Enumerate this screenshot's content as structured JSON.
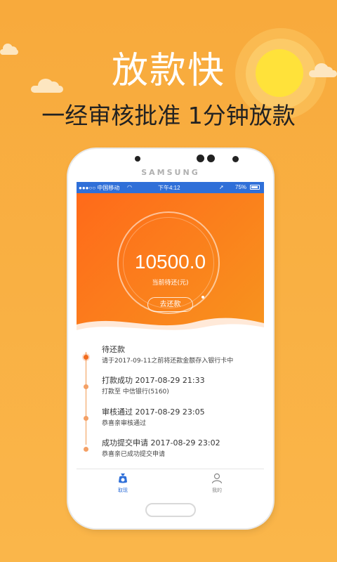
{
  "promo": {
    "headline": "放款快",
    "subline": "一经审核批准 1分钟放款"
  },
  "phone": {
    "brand": "SAMSUNG"
  },
  "status_bar": {
    "carrier": "●●●○○ 中国移动",
    "time": "下午4:12",
    "battery": "75%"
  },
  "loan": {
    "amount": "10500.0",
    "amount_label": "当前待还(元)",
    "repay_button": "去还款"
  },
  "timeline": [
    {
      "title": "待还款",
      "desc": "请于2017-09-11之前将还款金额存入银行卡中"
    },
    {
      "title": "打款成功 2017-08-29 21:33",
      "desc": "打款至 中信银行(5160)"
    },
    {
      "title": "审核通过 2017-08-29 23:05",
      "desc": "恭喜亲审核通过"
    },
    {
      "title": "成功提交申请 2017-08-29 23:02",
      "desc": "恭喜亲已成功提交申请"
    }
  ],
  "tabs": [
    {
      "label": "取现",
      "icon": "cash-bag-icon",
      "active": true
    },
    {
      "label": "我的",
      "icon": "person-icon",
      "active": false
    }
  ],
  "colors": {
    "background": "#f9b041",
    "hero_start": "#ff6a1a",
    "hero_end": "#f7941e",
    "status_bar": "#2f6fd8",
    "timeline_accent": "#f26b1d",
    "tab_active": "#2f6fd8",
    "tab_inactive": "#888888"
  }
}
